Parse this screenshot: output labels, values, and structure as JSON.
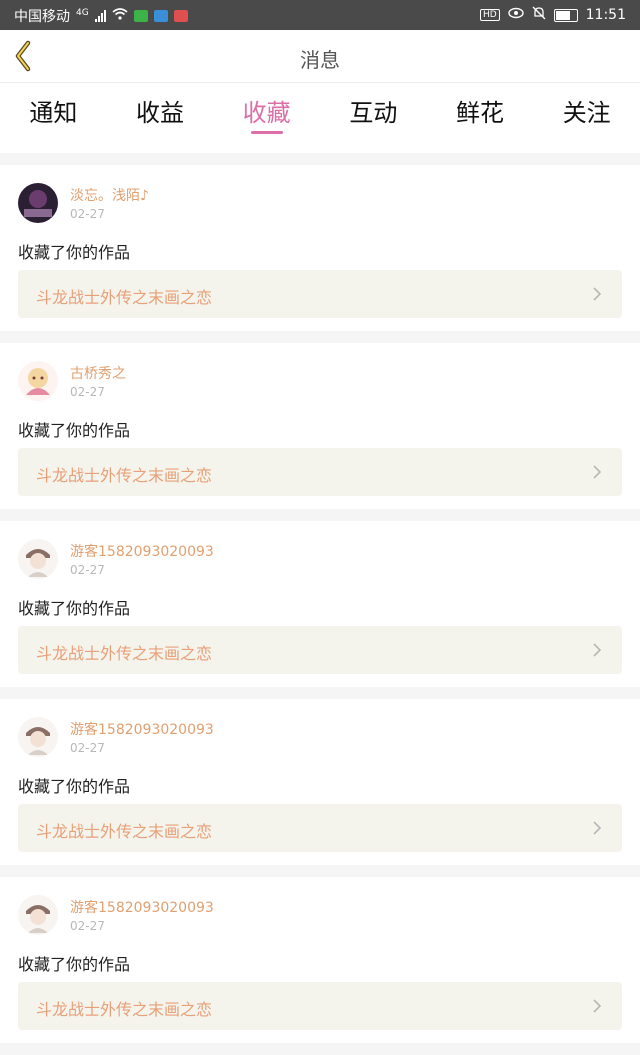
{
  "status_bar": {
    "carrier": "中国移动",
    "network": "4G",
    "time": "11:51"
  },
  "header": {
    "title": "消息",
    "back_icon": "chevron-left-icon"
  },
  "tabs": [
    {
      "label": "通知",
      "active": false
    },
    {
      "label": "收益",
      "active": false
    },
    {
      "label": "收藏",
      "active": true
    },
    {
      "label": "互动",
      "active": false
    },
    {
      "label": "鲜花",
      "active": false
    },
    {
      "label": "关注",
      "active": false
    }
  ],
  "colors": {
    "accent": "#dd6fa8",
    "username": "#e0a070",
    "work_title": "#e8a078",
    "link_bg": "#f4f3ec"
  },
  "messages": [
    {
      "user": "淡忘。浅陌♪",
      "date": "02-27",
      "action": "收藏了你的作品",
      "work": "斗龙战士外传之末画之恋"
    },
    {
      "user": "古桥秀之",
      "date": "02-27",
      "action": "收藏了你的作品",
      "work": "斗龙战士外传之末画之恋"
    },
    {
      "user": "游客1582093020093",
      "date": "02-27",
      "action": "收藏了你的作品",
      "work": "斗龙战士外传之末画之恋"
    },
    {
      "user": "游客1582093020093",
      "date": "02-27",
      "action": "收藏了你的作品",
      "work": "斗龙战士外传之末画之恋"
    },
    {
      "user": "游客1582093020093",
      "date": "02-27",
      "action": "收藏了你的作品",
      "work": "斗龙战士外传之末画之恋"
    }
  ]
}
